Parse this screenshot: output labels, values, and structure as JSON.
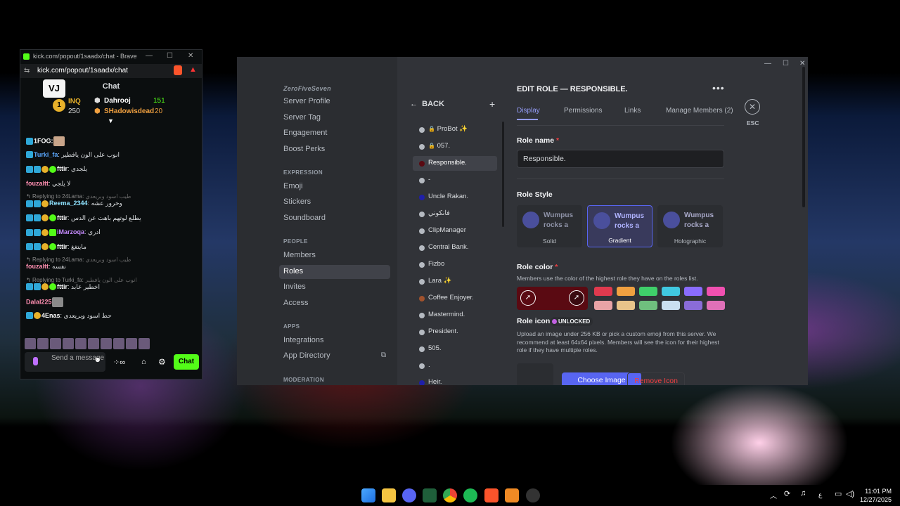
{
  "kick": {
    "title": "kick.com/popout/1saadx/chat - Brave",
    "url": "kick.com/popout/1saadx/chat",
    "chat_label": "Chat",
    "logo": "VJ",
    "leader1": {
      "name": "INQ",
      "value": "250"
    },
    "leader2": {
      "name": "Dahrooj",
      "value": "151"
    },
    "leader3": {
      "name": "SHadowisdead",
      "value": "20"
    },
    "messages": [
      {
        "user": "1FOG:",
        "text": "",
        "color": "#ffffff"
      },
      {
        "user": "Turki_fa",
        "text": ": انوب على الون يافطير",
        "color": "#5aa8ff"
      },
      {
        "user": "fttir",
        "text": ": يلجدي",
        "color": "#ffffff"
      },
      {
        "user": "fouzaltt",
        "text": ": لا يلجي",
        "color": "#ff8fb1"
      },
      {
        "reply": "Replying to 24Lama:",
        "reply_text": "طيب اسود وبريعدي"
      },
      {
        "user": "Reema_2344",
        "text": ": وخرور عشه",
        "color": "#8fe3ff"
      },
      {
        "user": "fttir",
        "text": ": يطلع لوتهم باهت عن الدس",
        "color": "#ffffff"
      },
      {
        "user": "iMarzoqa",
        "text": ": ادري",
        "color": "#c68bff"
      },
      {
        "user": "fttir",
        "text": ": مايتغغ",
        "color": "#ffffff"
      },
      {
        "reply": "Replying to 24Lama:",
        "reply_text": "طيب اسود وبريعدي"
      },
      {
        "user": "fouzaltt",
        "text": ": نفسه",
        "color": "#ff8fb1"
      },
      {
        "reply": "Replying to Turki_fa:",
        "reply_text": "انوب على الون يافطير"
      },
      {
        "user": "fttir",
        "text": ": اخطير عابد",
        "color": "#ffffff"
      },
      {
        "user": "Dalal225",
        "text": ":",
        "color": "#ff8fb1"
      },
      {
        "user": "4Enas",
        "text": ": حط اسود وبريعدي",
        "color": "#ffffff"
      }
    ],
    "input_placeholder": "Send a message",
    "chat_button": "Chat"
  },
  "discord": {
    "server_name": "ZeroFiveSeven",
    "nav": {
      "items_top": [
        "Server Profile",
        "Server Tag",
        "Engagement",
        "Boost Perks"
      ],
      "expression_header": "EXPRESSION",
      "items_expression": [
        "Emoji",
        "Stickers",
        "Soundboard"
      ],
      "people_header": "PEOPLE",
      "items_people": [
        "Members",
        "Roles",
        "Invites",
        "Access"
      ],
      "apps_header": "APPS",
      "items_apps": [
        "Integrations",
        "App Directory"
      ],
      "moderation_header": "MODERATION"
    },
    "back_label": "BACK",
    "roles": [
      {
        "name": "ProBot ✨",
        "color": "#b5bac1",
        "locked": true
      },
      {
        "name": "057.",
        "color": "#b5bac1",
        "locked": true
      },
      {
        "name": "Responsible.",
        "color": "#5a0a12",
        "selected": true
      },
      {
        "name": "-",
        "color": "#b5bac1"
      },
      {
        "name": "Uncle Rakan.",
        "color": "#1f1fa8"
      },
      {
        "name": "فانكوني",
        "color": "#b5bac1"
      },
      {
        "name": "ClipManager",
        "color": "#b5bac1"
      },
      {
        "name": "Central Bank.",
        "color": "#b5bac1"
      },
      {
        "name": "Fizbo",
        "color": "#b5bac1"
      },
      {
        "name": "Lara ✨",
        "color": "#b5bac1"
      },
      {
        "name": "Coffee Enjoyer.",
        "color": "#a0522d"
      },
      {
        "name": "Mastermind.",
        "color": "#b5bac1"
      },
      {
        "name": "President.",
        "color": "#b5bac1"
      },
      {
        "name": "505.",
        "color": "#b5bac1"
      },
      {
        "name": ".",
        "color": "#b5bac1"
      },
      {
        "name": "Heir.",
        "color": "#1f1fa8"
      }
    ],
    "edit_title": "EDIT ROLE — RESPONSIBLE.",
    "tabs": [
      "Display",
      "Permissions",
      "Links",
      "Manage Members (2)"
    ],
    "esc_label": "ESC",
    "role_name_label": "Role name",
    "role_name_value": "Responsible.",
    "role_style_label": "Role Style",
    "style_cards": [
      {
        "label": "Solid",
        "preview": "Wumpus rocks a"
      },
      {
        "label": "Gradient",
        "preview": "Wumpus rocks a"
      },
      {
        "label": "Holographic",
        "preview": "Wumpus rocks a"
      }
    ],
    "role_color_label": "Role color",
    "role_color_help": "Members use the color of the highest role they have on the roles list.",
    "selected_color": "#5a0a12",
    "swatches_top": [
      "#e03a4e",
      "#f0a040",
      "#3fcf6a",
      "#40c8e0",
      "#8a6cff",
      "#f050b0"
    ],
    "swatches_bottom": [
      "#e8a3a6",
      "#e8c48a",
      "#6fbf7e",
      "#c9dff0",
      "#8a6cd8",
      "#e070b8"
    ],
    "role_icon_label": "Role icon",
    "unlocked_badge": "UNLOCKED",
    "role_icon_help": "Upload an image under 256 KB or pick a custom emoji from this server. We recommend at least 64x64 pixels. Members will see the icon for their highest role if they have multiple roles.",
    "choose_image": "Choose Image",
    "remove_icon": "Remove Icon"
  },
  "taskbar": {
    "time": "11:01 PM",
    "date": "12/27/2025",
    "lang": "ع"
  }
}
